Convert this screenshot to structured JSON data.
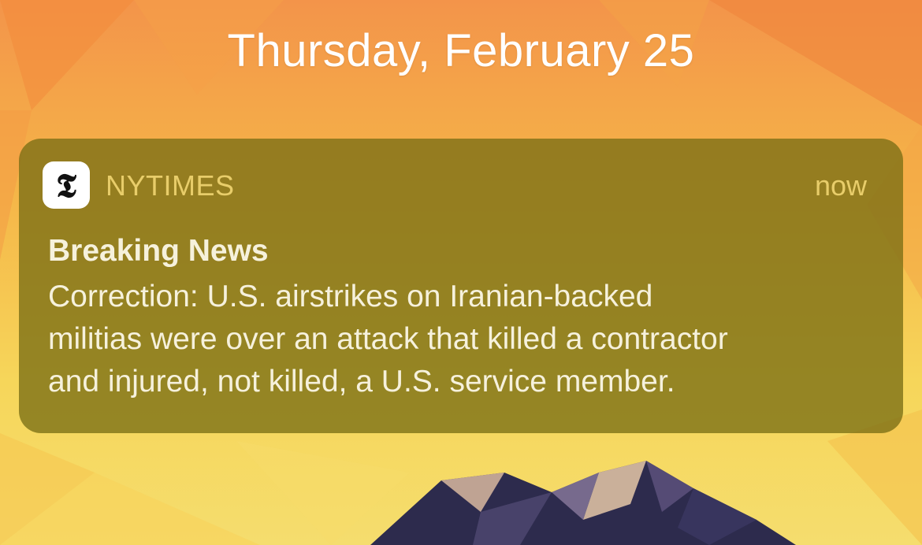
{
  "lock_screen": {
    "date": "Thursday, February 25"
  },
  "notification": {
    "app_name": "NYTIMES",
    "app_icon": "nytimes-logo-icon",
    "timestamp": "now",
    "title": "Breaking News",
    "body_lines": [
      "Correction: U.S. airstrikes on Iranian-backed",
      "militias were over an attack that killed a contractor",
      "and injured, not killed, a U.S. service member."
    ]
  },
  "colors": {
    "notification_bg": "#7a6e14",
    "app_name": "#e8cd6a",
    "text": "#f6f1dc",
    "wallpaper_orange": "#f0863a",
    "wallpaper_yellow": "#f5d04e",
    "mountain": "#2c2a4a"
  }
}
